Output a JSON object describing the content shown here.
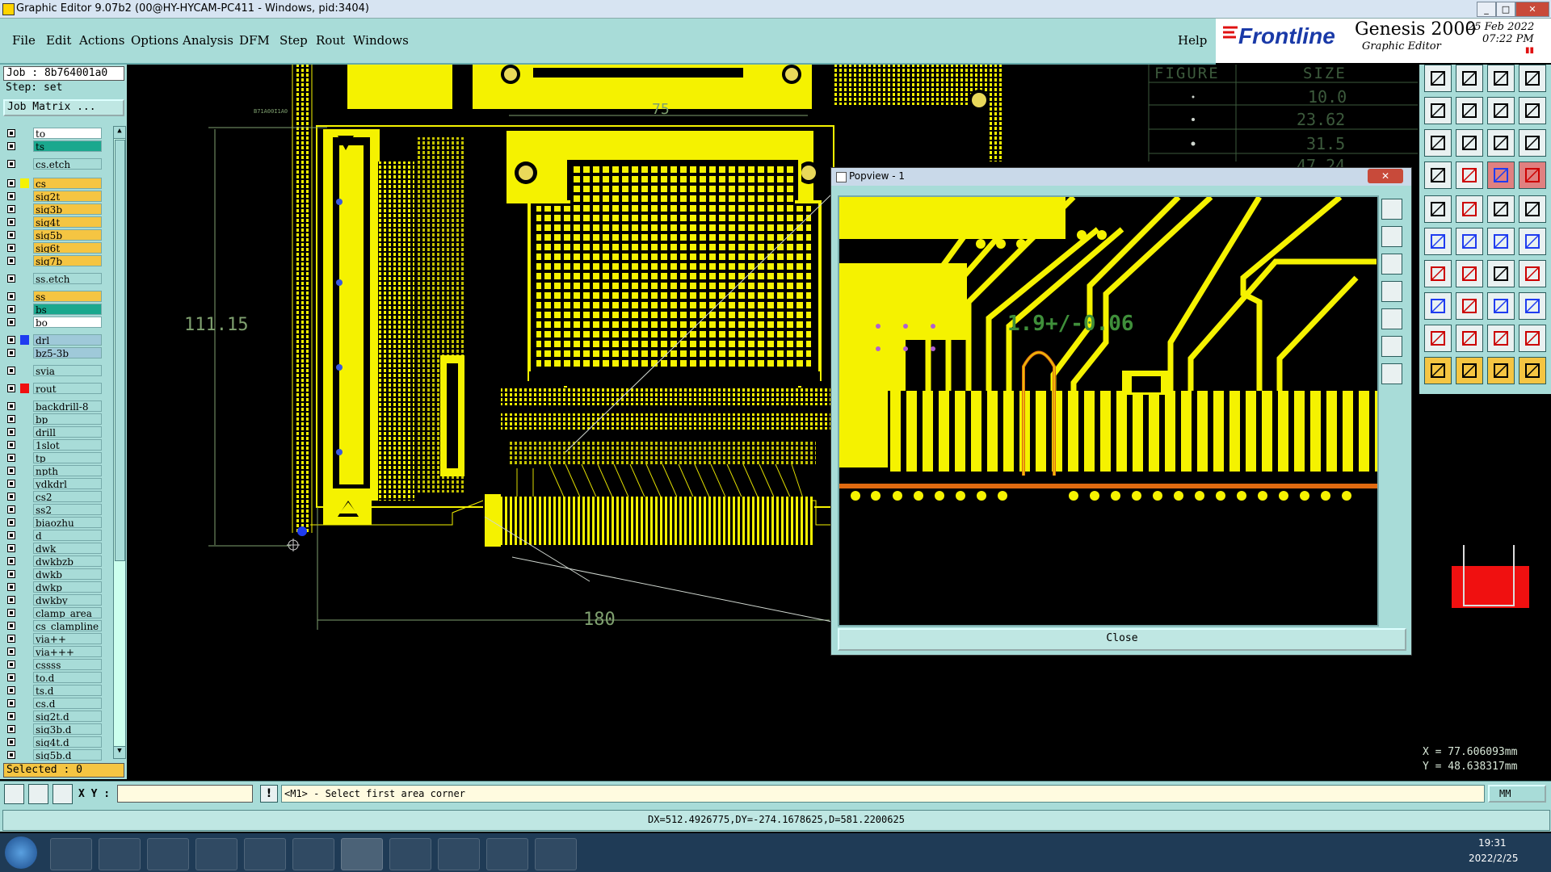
{
  "titlebar": {
    "title": "Graphic Editor 9.07b2 (00@HY-HYCAM-PC411 - Windows, pid:3404)"
  },
  "menu": {
    "items": [
      "File",
      "Edit",
      "Actions",
      "Options",
      "Analysis",
      "DFM",
      "Step",
      "Rout",
      "Windows"
    ],
    "help": "Help"
  },
  "brand": {
    "logo": "Frontline",
    "product": "Genesis 2000",
    "subtitle": "Graphic Editor",
    "date": "25 Feb 2022",
    "time": "07:22 PM"
  },
  "job": {
    "job_label": "Job : 8b764001a0",
    "step_label": "Step: set",
    "matrix_button": "Job Matrix ...",
    "selected": "Selected : 0"
  },
  "layers": [
    {
      "name": "to",
      "color": "#ffffff",
      "swatch": ""
    },
    {
      "name": "ts",
      "color": "#1aa88e",
      "swatch": ""
    },
    {
      "name": "cs.etch",
      "color": "#a8dcd8",
      "swatch": ""
    },
    {
      "name": "cs",
      "color": "#f5c542",
      "swatch": "#f5f200"
    },
    {
      "name": "sig2t",
      "color": "#f5c542",
      "swatch": ""
    },
    {
      "name": "sig3b",
      "color": "#f5c542",
      "swatch": ""
    },
    {
      "name": "sig4t",
      "color": "#f5c542",
      "swatch": ""
    },
    {
      "name": "sig5b",
      "color": "#f5c542",
      "swatch": ""
    },
    {
      "name": "sig6t",
      "color": "#f5c542",
      "swatch": ""
    },
    {
      "name": "sig7b",
      "color": "#f5c542",
      "swatch": ""
    },
    {
      "name": "ss.etch",
      "color": "#a8dcd8",
      "swatch": ""
    },
    {
      "name": "ss",
      "color": "#f5c542",
      "swatch": ""
    },
    {
      "name": "bs",
      "color": "#1aa88e",
      "swatch": ""
    },
    {
      "name": "bo",
      "color": "#ffffff",
      "swatch": ""
    },
    {
      "name": "drl",
      "color": "#9fc9d9",
      "swatch": "#1f3cf0"
    },
    {
      "name": "bz5-3b",
      "color": "#9fc9d9",
      "swatch": ""
    },
    {
      "name": "svia",
      "color": "#a8dcd8",
      "swatch": ""
    },
    {
      "name": "rout",
      "color": "#a8dcd8",
      "swatch": "#f01010"
    },
    {
      "name": "backdrill-8",
      "color": "#a8dcd8",
      "swatch": ""
    },
    {
      "name": "bp",
      "color": "#a8dcd8",
      "swatch": ""
    },
    {
      "name": "drill",
      "color": "#a8dcd8",
      "swatch": ""
    },
    {
      "name": "1slot",
      "color": "#a8dcd8",
      "swatch": ""
    },
    {
      "name": "tp",
      "color": "#a8dcd8",
      "swatch": ""
    },
    {
      "name": "npth",
      "color": "#a8dcd8",
      "swatch": ""
    },
    {
      "name": "ydkdrl",
      "color": "#a8dcd8",
      "swatch": ""
    },
    {
      "name": "cs2",
      "color": "#a8dcd8",
      "swatch": ""
    },
    {
      "name": "ss2",
      "color": "#a8dcd8",
      "swatch": ""
    },
    {
      "name": "biaozhu",
      "color": "#a8dcd8",
      "swatch": ""
    },
    {
      "name": "d",
      "color": "#a8dcd8",
      "swatch": ""
    },
    {
      "name": "dwk",
      "color": "#a8dcd8",
      "swatch": ""
    },
    {
      "name": "dwkbzb",
      "color": "#a8dcd8",
      "swatch": ""
    },
    {
      "name": "dwkb",
      "color": "#a8dcd8",
      "swatch": ""
    },
    {
      "name": "dwkp",
      "color": "#a8dcd8",
      "swatch": ""
    },
    {
      "name": "dwkby",
      "color": "#a8dcd8",
      "swatch": ""
    },
    {
      "name": "clamp_area",
      "color": "#a8dcd8",
      "swatch": ""
    },
    {
      "name": "cs_clampline",
      "color": "#a8dcd8",
      "swatch": ""
    },
    {
      "name": "via++",
      "color": "#a8dcd8",
      "swatch": ""
    },
    {
      "name": "via+++",
      "color": "#a8dcd8",
      "swatch": ""
    },
    {
      "name": "cssss",
      "color": "#a8dcd8",
      "swatch": ""
    },
    {
      "name": "to.d",
      "color": "#a8dcd8",
      "swatch": ""
    },
    {
      "name": "ts.d",
      "color": "#a8dcd8",
      "swatch": ""
    },
    {
      "name": "cs.d",
      "color": "#a8dcd8",
      "swatch": ""
    },
    {
      "name": "sig2t.d",
      "color": "#a8dcd8",
      "swatch": ""
    },
    {
      "name": "sig3b.d",
      "color": "#a8dcd8",
      "swatch": ""
    },
    {
      "name": "sig4t.d",
      "color": "#a8dcd8",
      "swatch": ""
    },
    {
      "name": "sig5b.d",
      "color": "#a8dcd8",
      "swatch": ""
    }
  ],
  "canvas": {
    "dim_height": "111.15",
    "dim_width": "180",
    "dim_top": "75",
    "board_text": "B71A00I1A0",
    "figure_table": {
      "headers": [
        "FIGURE",
        "SIZE"
      ],
      "sizes": [
        "10.0",
        "23.62",
        "31.5",
        "47.24"
      ]
    }
  },
  "popview": {
    "title": "Popview - 1",
    "annotation": "1.9+/-0.06",
    "close": "Close"
  },
  "command": {
    "xy_label": "X Y :",
    "xy_value": "",
    "prompt": "<M1> - Select first area corner",
    "units": "MM"
  },
  "status": {
    "text": "DX=512.4926775,DY=-274.1678625,D=581.2200625"
  },
  "coords": {
    "x": "X = 77.606093mm",
    "y": "Y = 48.638317mm"
  },
  "taskbar": {
    "time": "19:31",
    "date": "2022/2/25"
  }
}
